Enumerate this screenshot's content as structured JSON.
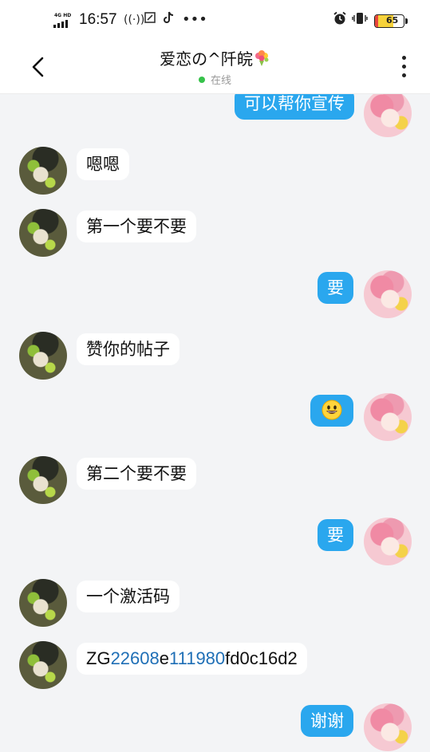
{
  "status_bar": {
    "network": "4G HD",
    "time": "16:57",
    "icons": [
      "nfc-icon",
      "screenshot-icon",
      "tiktok-icon",
      "more-dots-icon",
      "alarm-icon",
      "vibrate-icon"
    ],
    "battery": 65
  },
  "header": {
    "back_icon": "chevron-left-icon",
    "contact_name": "爱恋の^阡皖",
    "name_emoji": "bouquet-icon",
    "presence": "在线",
    "menu_icon": "vertical-dots-icon"
  },
  "colors": {
    "outgoing_bubble": "#2aa7ee",
    "incoming_bubble": "#ffffff",
    "background": "#f3f4f6",
    "online": "#36c24a",
    "number_text": "#1f6fb6"
  },
  "messages": [
    {
      "from": "self",
      "text": "可以帮你宣传"
    },
    {
      "from": "contact",
      "text": "嗯嗯"
    },
    {
      "from": "contact",
      "text": "第一个要不要"
    },
    {
      "from": "self",
      "text": "要"
    },
    {
      "from": "contact",
      "text": "赞你的帖子"
    },
    {
      "from": "self",
      "text": "",
      "emoji": "grinning-face-icon"
    },
    {
      "from": "contact",
      "text": "第二个要不要"
    },
    {
      "from": "self",
      "text": "要"
    },
    {
      "from": "contact",
      "text": "一个激活码"
    },
    {
      "from": "contact",
      "code_parts": [
        "ZG",
        "22608",
        "e",
        "111980",
        "fd0c16d2"
      ]
    },
    {
      "from": "self",
      "text": "谢谢"
    }
  ]
}
